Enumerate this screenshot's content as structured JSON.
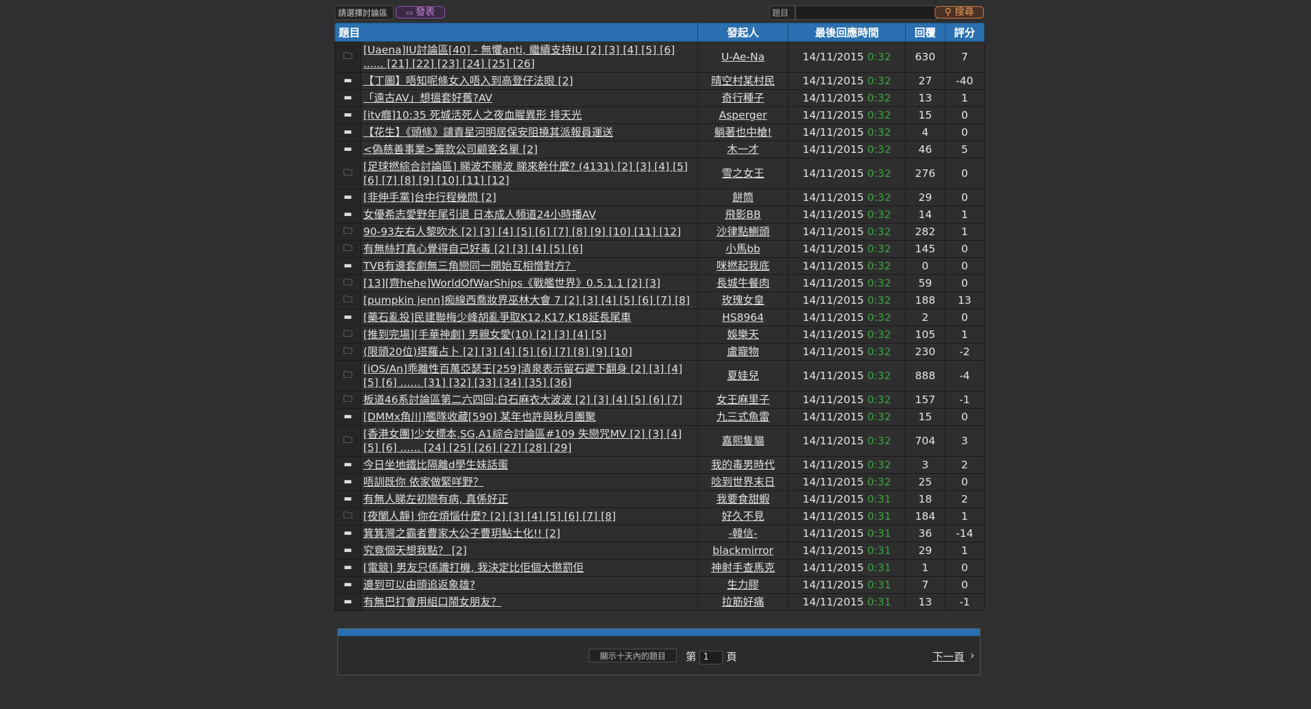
{
  "topbar": {
    "board_select": "請選擇討論區",
    "post_label": "發表",
    "post_icon": "chat-icon",
    "search_label": "題目",
    "search_value": "",
    "search_button": "搜尋",
    "search_icon": "search-icon"
  },
  "table": {
    "headers": {
      "title": "題目",
      "author": "發起人",
      "last_reply": "最後回應時間",
      "replies": "回覆",
      "rating": "評分"
    },
    "rows": [
      {
        "icon": "open-folder-icon",
        "title": "[Uaena]IU討論區[40] - 無懼anti, 繼續支持IU [2] [3] [4] [5] [6] ...... [21] [22] [23] [24] [25] [26]",
        "author": "U-Ae-Na",
        "date": "14/11/2015",
        "time": "0:32",
        "replies": "630",
        "rating": "7",
        "multi": true
      },
      {
        "icon": "closed-folder-icon",
        "title": "【丁圖】唔知呢條女入唔入到高登仔法眼 [2]",
        "author": "晴空村某村民",
        "date": "14/11/2015",
        "time": "0:32",
        "replies": "27",
        "rating": "-40"
      },
      {
        "icon": "closed-folder-icon",
        "title": "「遠古AV」想搵套好舊?AV",
        "author": "奇行種子",
        "date": "14/11/2015",
        "time": "0:32",
        "replies": "13",
        "rating": "1"
      },
      {
        "icon": "closed-folder-icon",
        "title": "[itv癮]10:35 死城活死人之夜血腥異形 排天光",
        "author": "Asperger",
        "date": "14/11/2015",
        "time": "0:32",
        "replies": "15",
        "rating": "0"
      },
      {
        "icon": "closed-folder-icon",
        "title": "【花生】《頭條》譴責星河明居保安阻撓其派報員運送",
        "author": "躺著也中槍!",
        "date": "14/11/2015",
        "time": "0:32",
        "replies": "4",
        "rating": "0"
      },
      {
        "icon": "closed-folder-icon",
        "title": "<偽慈善事業>籌款公司顧客名單 [2]",
        "author": "木一才",
        "date": "14/11/2015",
        "time": "0:32",
        "replies": "46",
        "rating": "5"
      },
      {
        "icon": "open-folder-icon",
        "title": "[足球撚綜合討論區] 睇波不睇波 睇來幹什麼? (4131) [2] [3] [4] [5] [6] [7] [8] [9] [10] [11] [12]",
        "author": "雪之女王",
        "date": "14/11/2015",
        "time": "0:32",
        "replies": "276",
        "rating": "0",
        "multi": true
      },
      {
        "icon": "closed-folder-icon",
        "title": "[非伸手黨]台中行程幾問 [2]",
        "author": "餅筒",
        "date": "14/11/2015",
        "time": "0:32",
        "replies": "29",
        "rating": "0"
      },
      {
        "icon": "closed-folder-icon",
        "title": "女優希志愛野年尾引退 日本成人頻道24小時播AV",
        "author": "飛影BB",
        "date": "14/11/2015",
        "time": "0:32",
        "replies": "14",
        "rating": "1"
      },
      {
        "icon": "open-folder-icon",
        "title": "90-93左右人黎吹水 [2] [3] [4] [5] [6] [7] [8] [9] [10] [11] [12]",
        "author": "沙律點鰂頭",
        "date": "14/11/2015",
        "time": "0:32",
        "replies": "282",
        "rating": "1"
      },
      {
        "icon": "open-folder-icon",
        "title": "有無絲打真心覺得自己好毒 [2] [3] [4] [5] [6]",
        "author": "小馬bb",
        "date": "14/11/2015",
        "time": "0:32",
        "replies": "145",
        "rating": "0"
      },
      {
        "icon": "closed-folder-icon",
        "title": "TVB有邊套劇無三角戀同一開始互相憎對方？",
        "author": "咪撚起我底",
        "date": "14/11/2015",
        "time": "0:32",
        "replies": "0",
        "rating": "0"
      },
      {
        "icon": "open-folder-icon",
        "title": "[13][齊hehe]WorldOfWarShips《戰艦世界》0.5.1.1 [2] [3]",
        "author": "長城牛餐肉",
        "date": "14/11/2015",
        "time": "0:32",
        "replies": "59",
        "rating": "0"
      },
      {
        "icon": "open-folder-icon",
        "title": "[pumpkin jenn]痴線西喬妝界巫林大會 7 [2] [3] [4] [5] [6] [7] [8]",
        "author": "玫瑰女皇",
        "date": "14/11/2015",
        "time": "0:32",
        "replies": "188",
        "rating": "13"
      },
      {
        "icon": "closed-folder-icon",
        "title": "[藥石亂投]民建聯梅少峰胡亂爭取K12,K17,K18延長尾車",
        "author": "HS8964",
        "date": "14/11/2015",
        "time": "0:32",
        "replies": "2",
        "rating": "0"
      },
      {
        "icon": "open-folder-icon",
        "title": "[推到完場][手華神劇] 男親女愛(10) [2] [3] [4] [5]",
        "author": "娛樂天",
        "date": "14/11/2015",
        "time": "0:32",
        "replies": "105",
        "rating": "1"
      },
      {
        "icon": "open-folder-icon",
        "title": "(限頭20位)塔羅占卜 [2] [3] [4] [5] [6] [7] [8] [9] [10]",
        "author": "盧寵物",
        "date": "14/11/2015",
        "time": "0:32",
        "replies": "230",
        "rating": "-2"
      },
      {
        "icon": "open-folder-icon",
        "title": "[iOS/An]乖離性百萬亞瑟王[259]清泉表示留石遲下翻身 [2] [3] [4] [5] [6] ...... [31] [32] [33] [34] [35] [36]",
        "author": "夏娃兒",
        "date": "14/11/2015",
        "time": "0:32",
        "replies": "888",
        "rating": "-4",
        "multi": true
      },
      {
        "icon": "open-folder-icon",
        "title": "板道46系討論區第二六四回:白石麻衣大波波 [2] [3] [4] [5] [6] [7]",
        "author": "女王麻里子",
        "date": "14/11/2015",
        "time": "0:32",
        "replies": "157",
        "rating": "-1"
      },
      {
        "icon": "closed-folder-icon",
        "title": "[DMMx角川]艦隊收藏[590] 某年也許與秋月團聚",
        "author": "九三式魚雷",
        "date": "14/11/2015",
        "time": "0:32",
        "replies": "15",
        "rating": "0"
      },
      {
        "icon": "open-folder-icon",
        "title": "[香港女團]少女標本,SG,A1綜合討論區#109 失戀咒MV [2] [3] [4] [5] [6] ...... [24] [25] [26] [27] [28] [29]",
        "author": "嘉熙隻貓",
        "date": "14/11/2015",
        "time": "0:32",
        "replies": "704",
        "rating": "3",
        "multi": true
      },
      {
        "icon": "closed-folder-icon",
        "title": "今日坐地鐵比隔離d學生妹話蛋",
        "author": "我的毒男時代",
        "date": "14/11/2015",
        "time": "0:32",
        "replies": "3",
        "rating": "2"
      },
      {
        "icon": "closed-folder-icon",
        "title": "唔訓既你 依家做緊咩野？",
        "author": "唸到世界末日",
        "date": "14/11/2015",
        "time": "0:32",
        "replies": "25",
        "rating": "0"
      },
      {
        "icon": "closed-folder-icon",
        "title": "有無人睇左初戀有病, 真係好正",
        "author": "我要食甜蝦",
        "date": "14/11/2015",
        "time": "0:31",
        "replies": "18",
        "rating": "2"
      },
      {
        "icon": "open-folder-icon",
        "title": "[夜闌人靜] 你在煩惱什麼? [2] [3] [4] [5] [6] [7] [8]",
        "author": "好久不見",
        "date": "14/11/2015",
        "time": "0:31",
        "replies": "184",
        "rating": "1"
      },
      {
        "icon": "closed-folder-icon",
        "title": "箕箕灣之霸者曹家大公子曹玥鮎土化!! [2]",
        "author": "-韓信-",
        "date": "14/11/2015",
        "time": "0:31",
        "replies": "36",
        "rating": "-14"
      },
      {
        "icon": "closed-folder-icon",
        "title": "究竟個天想我點？ [2]",
        "author": "blackmirror",
        "date": "14/11/2015",
        "time": "0:31",
        "replies": "29",
        "rating": "1"
      },
      {
        "icon": "closed-folder-icon",
        "title": "[電競] 男友只係識打機, 我決定比佢個大懲罰佢",
        "author": "神射手查馬克",
        "date": "14/11/2015",
        "time": "0:31",
        "replies": "1",
        "rating": "0"
      },
      {
        "icon": "closed-folder-icon",
        "title": "邊到可以由頭追返象雄?",
        "author": "生力膠",
        "date": "14/11/2015",
        "time": "0:31",
        "replies": "7",
        "rating": "0"
      },
      {
        "icon": "closed-folder-icon",
        "title": "有無巴打會用組口鬧女朋友？",
        "author": "拉筋好痛",
        "date": "14/11/2015",
        "time": "0:31",
        "replies": "13",
        "rating": "-1"
      }
    ]
  },
  "pager": {
    "filter_label": "顯示十天內的題目",
    "page_prefix": "第",
    "page_value": "1",
    "page_suffix": "頁",
    "next_label": "下一頁",
    "next_icon": "chevron-right-icon"
  },
  "colors": {
    "header_blue": "#2b70b0",
    "time_green": "#3fa140",
    "post_purple": "#8e52a9",
    "search_orange": "#d27a42"
  }
}
